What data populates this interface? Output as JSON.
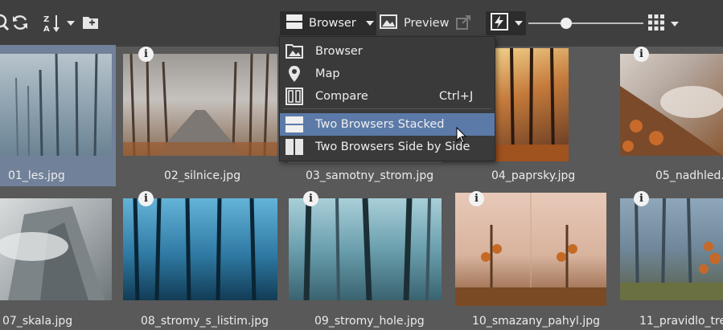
{
  "toolbar": {
    "mode_label": "Browser",
    "preview_label": "Preview",
    "icons": [
      "search-icon",
      "refresh-icon",
      "sort-za-icon",
      "add-folder-icon",
      "layout-stacked-icon",
      "preview-image-icon",
      "open-external-icon",
      "flash-icon",
      "grid-icon"
    ]
  },
  "menu": {
    "items": [
      {
        "label": "Browser",
        "shortcut": "",
        "icon": "folder-images-icon"
      },
      {
        "label": "Map",
        "shortcut": "",
        "icon": "map-pin-icon"
      },
      {
        "label": "Compare",
        "shortcut": "Ctrl+J",
        "icon": "compare-icon"
      },
      {
        "label": "Two Browsers Stacked",
        "shortcut": "",
        "icon": "two-stacked-icon",
        "highlighted": true
      },
      {
        "label": "Two Browsers Side by Side",
        "shortcut": "",
        "icon": "two-side-icon"
      }
    ]
  },
  "thumbnails": [
    {
      "name": "01_les.jpg",
      "selected": true
    },
    {
      "name": "02_silnice.jpg"
    },
    {
      "name": "03_samotny_strom.jpg"
    },
    {
      "name": "04_paprsky.jpg"
    },
    {
      "name": "05_nadhled.jpg"
    },
    {
      "name": "07_skala.jpg"
    },
    {
      "name": "08_stromy_s_listim.jpg"
    },
    {
      "name": "09_stromy_hole.jpg"
    },
    {
      "name": "10_smazany_pahyl.jpg"
    },
    {
      "name": "11_pravidlo_treti"
    }
  ],
  "colors": {
    "accent": "#5b7aa8",
    "selection": "#71819a",
    "toolbar": "#3f3f3f",
    "background": "#595959"
  }
}
